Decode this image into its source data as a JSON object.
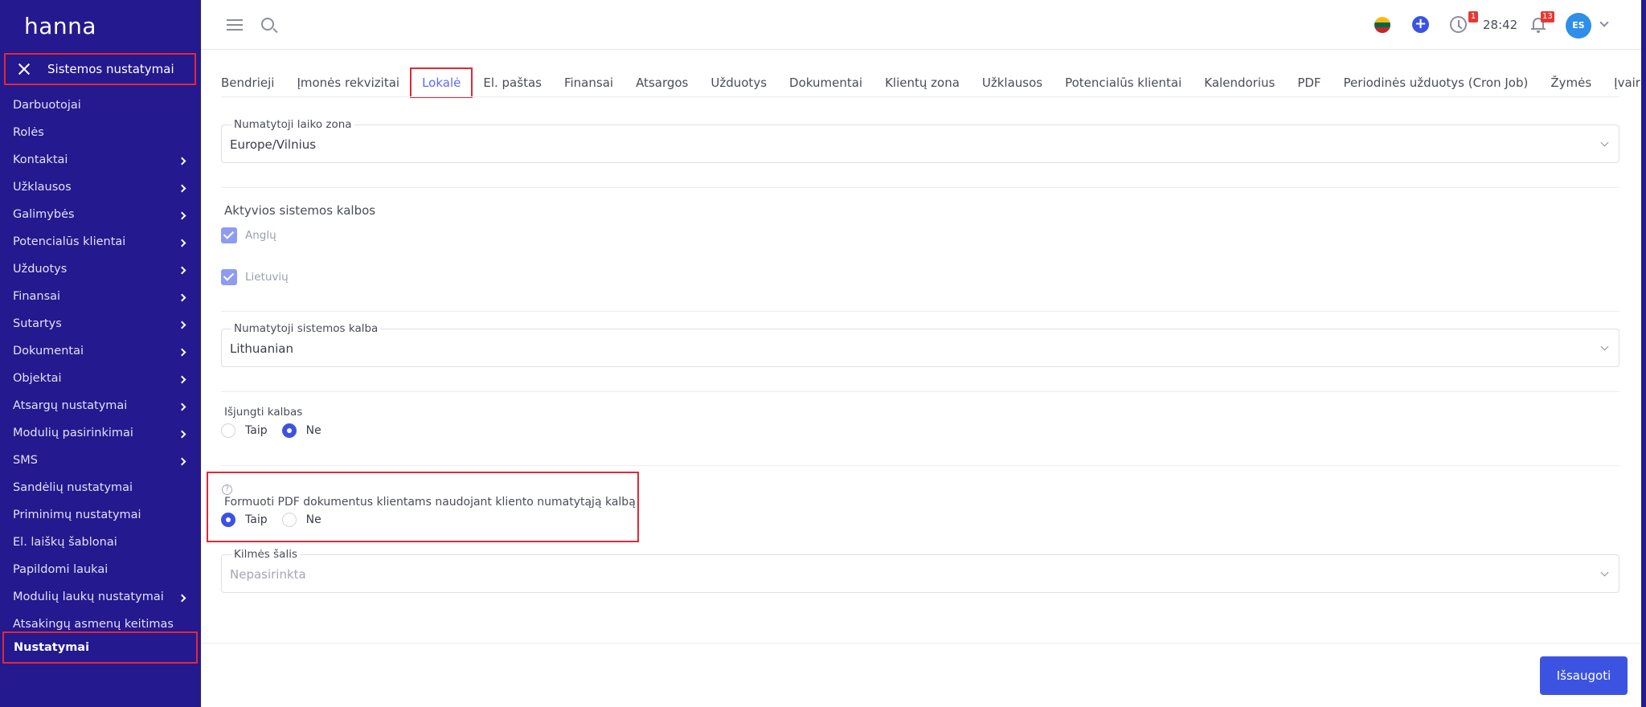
{
  "app": {
    "logo": "hanna"
  },
  "sidebar": {
    "header_title": "Sistemos nustatymai",
    "items": [
      {
        "label": "Darbuotojai",
        "has_children": false
      },
      {
        "label": "Rolės",
        "has_children": false
      },
      {
        "label": "Kontaktai",
        "has_children": true
      },
      {
        "label": "Užklausos",
        "has_children": true
      },
      {
        "label": "Galimybės",
        "has_children": true
      },
      {
        "label": "Potencialūs klientai",
        "has_children": true
      },
      {
        "label": "Užduotys",
        "has_children": true
      },
      {
        "label": "Finansai",
        "has_children": true
      },
      {
        "label": "Sutartys",
        "has_children": true
      },
      {
        "label": "Dokumentai",
        "has_children": true
      },
      {
        "label": "Objektai",
        "has_children": true
      },
      {
        "label": "Atsargų nustatymai",
        "has_children": true
      },
      {
        "label": "Modulių pasirinkimai",
        "has_children": true
      },
      {
        "label": "SMS",
        "has_children": true
      },
      {
        "label": "Sandėlių nustatymai",
        "has_children": false
      },
      {
        "label": "Priminimų nustatymai",
        "has_children": false
      },
      {
        "label": "El. laiškų šablonai",
        "has_children": false
      },
      {
        "label": "Papildomi laukai",
        "has_children": false
      },
      {
        "label": "Modulių laukų nustatymai",
        "has_children": true
      },
      {
        "label": "Atsakingų asmenų keitimas",
        "has_children": false
      }
    ],
    "active_item": "Nustatymai"
  },
  "topbar": {
    "clock_badge": "1",
    "timer": "28:42",
    "notifications_badge": "13",
    "avatar_initials": "ES",
    "colors": {
      "accent": "#3c53e1",
      "badge": "#e53935",
      "sidebar": "#24198e"
    }
  },
  "tabs": [
    {
      "label": "Bendrieji",
      "active": false
    },
    {
      "label": "Įmonės rekvizitai",
      "active": false
    },
    {
      "label": "Lokalė",
      "active": true
    },
    {
      "label": "El. paštas",
      "active": false
    },
    {
      "label": "Finansai",
      "active": false
    },
    {
      "label": "Atsargos",
      "active": false
    },
    {
      "label": "Užduotys",
      "active": false
    },
    {
      "label": "Dokumentai",
      "active": false
    },
    {
      "label": "Klientų zona",
      "active": false
    },
    {
      "label": "Užklausos",
      "active": false
    },
    {
      "label": "Potencialūs klientai",
      "active": false
    },
    {
      "label": "Kalendorius",
      "active": false
    },
    {
      "label": "PDF",
      "active": false
    },
    {
      "label": "Periodinės užduotys (Cron Job)",
      "active": false
    },
    {
      "label": "Žymės",
      "active": false
    },
    {
      "label": "Įvairūs",
      "active": false
    }
  ],
  "form": {
    "timezone": {
      "label": "Numatytoji laiko zona",
      "value": "Europe/Vilnius"
    },
    "active_languages": {
      "label": "Aktyvios sistemos kalbos",
      "options": [
        {
          "label": "Anglų",
          "checked": true
        },
        {
          "label": "Lietuvių",
          "checked": true
        }
      ]
    },
    "default_language": {
      "label": "Numatytoji sistemos kalba",
      "value": "Lithuanian"
    },
    "disable_languages": {
      "label": "Išjungti kalbas",
      "options": [
        "Taip",
        "Ne"
      ],
      "selected": "Ne"
    },
    "pdf_client_language": {
      "help_icon": "?",
      "label": "Formuoti PDF dokumentus klientams naudojant kliento numatytąją kalbą",
      "options": [
        "Taip",
        "Ne"
      ],
      "selected": "Taip"
    },
    "origin_country": {
      "label": "Kilmės šalis",
      "placeholder": "Nepasirinkta"
    }
  },
  "actions": {
    "save_label": "Išsaugoti"
  }
}
